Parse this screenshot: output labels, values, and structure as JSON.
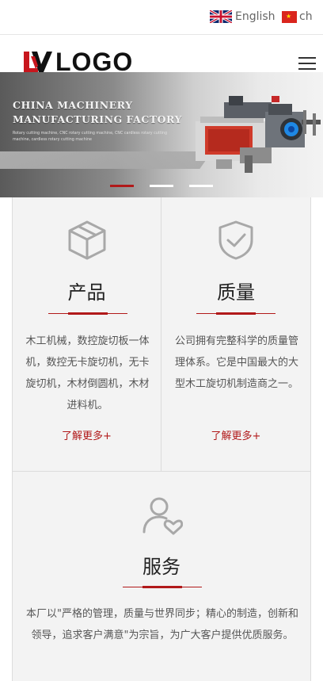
{
  "language_bar": {
    "english_label": "English",
    "chinese_label": "ch"
  },
  "header": {
    "logo_text": "LOGO"
  },
  "banner": {
    "title_line1": "CHINA MACHINERY",
    "title_line2": "MANUFACTURING FACTORY",
    "subtitle": "Rotary cutting machine, CNC rotary cutting machine, CNC cardless rotary cutting machine, cardless rotary cutting machine",
    "active_slide": 1,
    "slide_count": 3
  },
  "features": [
    {
      "title": "产品",
      "description": "木工机械，数控旋切板一体机，数控无卡旋切机，无卡旋切机，木材倒圆机，木材进料机。",
      "more_label": "了解更多+"
    },
    {
      "title": "质量",
      "description": "公司拥有完整科学的质量管理体系。它是中国最大的大型木工旋切机制造商之一。",
      "more_label": "了解更多+"
    },
    {
      "title": "服务",
      "description": "本厂以\"严格的管理，质量与世界同步；精心的制造，创新和领导，追求客户满意\"为宗旨，为广大客户提供优质服务。"
    }
  ],
  "colors": {
    "accent": "#b1191a",
    "card_bg": "#f3f3f3",
    "icon_gray": "#a8a8a8"
  }
}
